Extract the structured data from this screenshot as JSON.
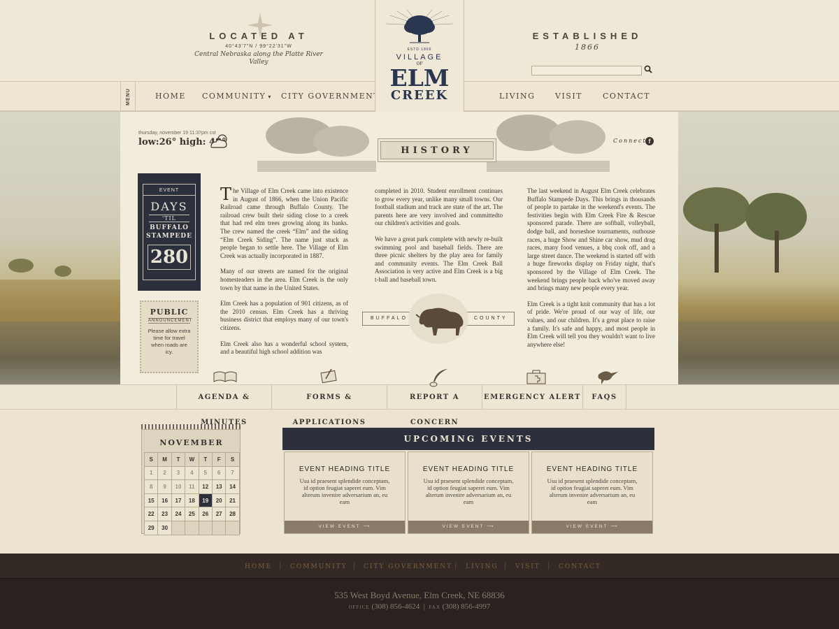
{
  "header": {
    "located": {
      "label": "LOCATED AT",
      "coords": "40°43'7\"N  /  99°22'31\"W",
      "description": "Central Nebraska along the Platte River Valley"
    },
    "established": {
      "label": "ESTABLISHED",
      "year": "1866"
    },
    "logo": {
      "est": "ESTD   1866",
      "village": "VILLAGE",
      "of": "OF",
      "elm": "ELM",
      "creek": "CREEK"
    },
    "menu_tab": "MENU",
    "search": {
      "value": "",
      "placeholder": ""
    },
    "nav_left": [
      {
        "label": "HOME"
      },
      {
        "label": "COMMUNITY"
      },
      {
        "label": "CITY GOVERNMENT"
      }
    ],
    "nav_right": [
      {
        "label": "LIVING"
      },
      {
        "label": "VISIT"
      },
      {
        "label": "CONTACT"
      }
    ]
  },
  "panel": {
    "date": "thursday, november 19 11:37pm cst",
    "weather": "low:26° high: 48°",
    "connect": "Connect",
    "section_title": "HISTORY",
    "ticket": {
      "event_label": "EVENT",
      "days": "DAYS",
      "til": "'TIL",
      "event_name_1": "BUFFALO",
      "event_name_2": "STAMPEDE",
      "count": "280"
    },
    "announcement": {
      "title": "PUBLIC",
      "subtitle": "ANNOUNCEMENT",
      "text": "Please allow extra time for travel when roads are icy."
    },
    "col1": {
      "dropcap": "T",
      "p1": "he Village of Elm Creek came into existence in August of 1866, when the Union Pacific Railroad came through Buffalo County. The railroad crew built their siding close to a creek that had red elm trees growing along its banks. The crew named the creek “Elm” and the siding “Elm Creek Siding”. The name just stuck as people began to settle here. The Village of Elm Creek was actually incorporated in 1887.",
      "p2": "Many of our streets are named for the original homesteaders in the area. Elm Creek is the only town by that name in the United States.",
      "p3": "Elm Creek has a population of 901 citizens, as of the 2010 census. Elm Creek has a thriving business district that employs many of our town's citizens.",
      "p4": "Elm Creek also has a wonderful school system, and a beautiful high school addition was"
    },
    "col2": {
      "p1": "completed in 2010. Student enrollment continues to grow every year, unlike many small towns. Our football stadium and track are state of the art. The parents here are very involved and committedto our children's activities and goals.",
      "p2": "We have a great park complete with newly re-built swimming pool and baseball fields. There are three picnic shelters by the play area for family and community events. The Elm Creek Ball Association is very active and Elm Creek is a big t-ball and baseball town.",
      "badge_left": "BUFFALO",
      "badge_right": "COUNTY"
    },
    "col3": {
      "p1": "The last weekend in August Elm Creek celebrates Buffalo Stampede Days. This brings in thousands of people to partake in the weekend's events. The festivities begin with Elm Creek Fire & Rescue sponsored parade. There are softball, volleyball, dodge ball, and horseshoe tournaments, outhouse races, a huge Show and Shine car show, mud drag races, many food venues, a bbq cook off, and a large street dance. The weekend is started off with a huge fireworks display on Friday night, that's sponsored by the Village of Elm Creek. The weekend brings people back who've moved away and brings many new people every year.",
      "p2": "Elm Creek is a tight knit community that has a lot of pride. We're proud of our way of life, our values, and our children. It's a great place to raise a family. It's safe and happy, and most people in Elm Creek will tell you they wouldn't want to live anywhere else!"
    }
  },
  "quicklinks": [
    {
      "label": "AGENDA & MINUTES",
      "icon": "book-icon"
    },
    {
      "label": "FORMS & APPLICATIONS",
      "icon": "scroll-icon"
    },
    {
      "label": "REPORT A CONCERN",
      "icon": "quill-icon"
    },
    {
      "label": "EMERGENCY ALERT",
      "icon": "first-aid-kit-icon"
    },
    {
      "label": "FAQS",
      "icon": "bird-icon"
    }
  ],
  "calendar": {
    "month": "NOVEMBER",
    "weekdays": [
      "S",
      "M",
      "T",
      "W",
      "T",
      "F",
      "S"
    ],
    "today": 19
  },
  "events": {
    "title": "UPCOMING EVENTS",
    "cards": [
      {
        "title": "EVENT HEADING TITLE",
        "body": "Usu id praesent splendide conceptam, id option feugiat saperet eum. Vim alterum invenire adversarium an, eu eam",
        "button": "VIEW EVENT"
      },
      {
        "title": "EVENT HEADING TITLE",
        "body": "Usu id praesent splendide conceptam, id option feugiat saperet eum. Vim alterum invenire adversarium an, eu eam",
        "button": "VIEW EVENT"
      },
      {
        "title": "EVENT HEADING TITLE",
        "body": "Usu id praesent splendide conceptam, id option feugiat saperet eum. Vim alterum invenire adversarium an, eu eam",
        "button": "VIEW EVENT"
      }
    ]
  },
  "footer": {
    "nav": [
      "HOME",
      "COMMUNITY",
      "CITY GOVERNMENT",
      "LIVING",
      "VISIT",
      "CONTACT"
    ],
    "address": "535 West Boyd Avenue, Elm Creek, NE 68836",
    "office_label": "OFFICE",
    "office_phone": "(308) 856-4624",
    "fax_label": "FAX",
    "fax_phone": "(308) 856-4997"
  },
  "colors": {
    "paper": "#efe8d6",
    "navy": "#2c2f3c",
    "logo_blue": "#2a3550",
    "footer": "#2a2220",
    "button_brown": "#8a7a68"
  }
}
